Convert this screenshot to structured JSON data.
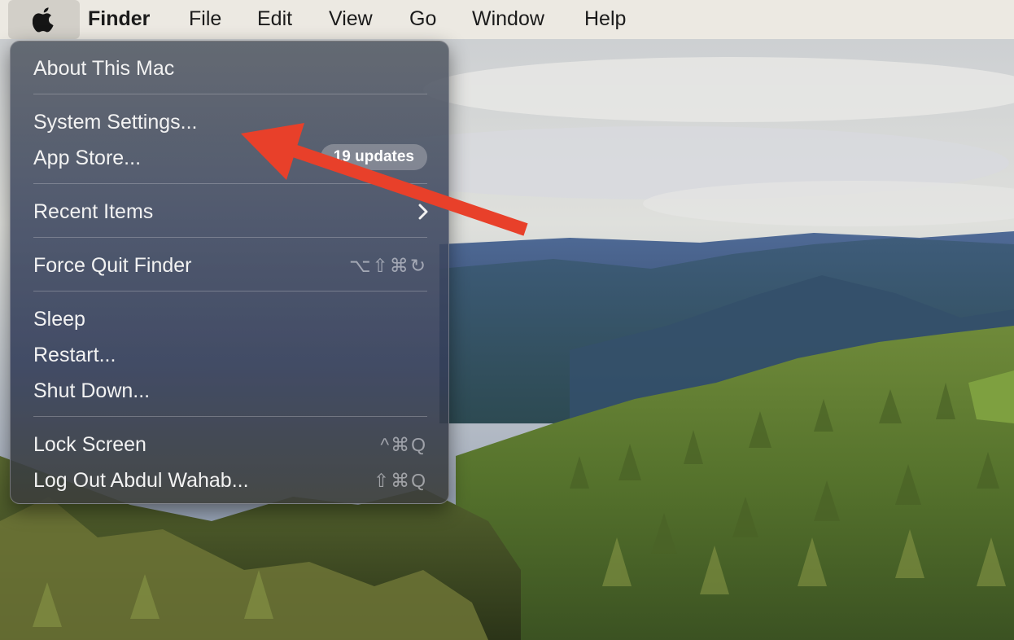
{
  "menubar": {
    "apple_icon": "apple-logo-icon",
    "app_name": "Finder",
    "menus": [
      "File",
      "Edit",
      "View",
      "Go",
      "Window",
      "Help"
    ]
  },
  "apple_menu": {
    "about": "About This Mac",
    "system_settings": "System Settings...",
    "app_store": "App Store...",
    "app_store_badge": "19 updates",
    "recent_items": "Recent Items",
    "recent_items_icon": "chevron-right-icon",
    "force_quit": "Force Quit Finder",
    "force_quit_shortcut": "⌥⇧⌘↻",
    "sleep": "Sleep",
    "restart": "Restart...",
    "shut_down": "Shut Down...",
    "lock_screen": "Lock Screen",
    "lock_screen_shortcut": "^⌘Q",
    "log_out": "Log Out Abdul Wahab...",
    "log_out_shortcut": "⇧⌘Q"
  },
  "annotation": {
    "arrow_color": "#e8402a",
    "points_to": "System Settings..."
  }
}
